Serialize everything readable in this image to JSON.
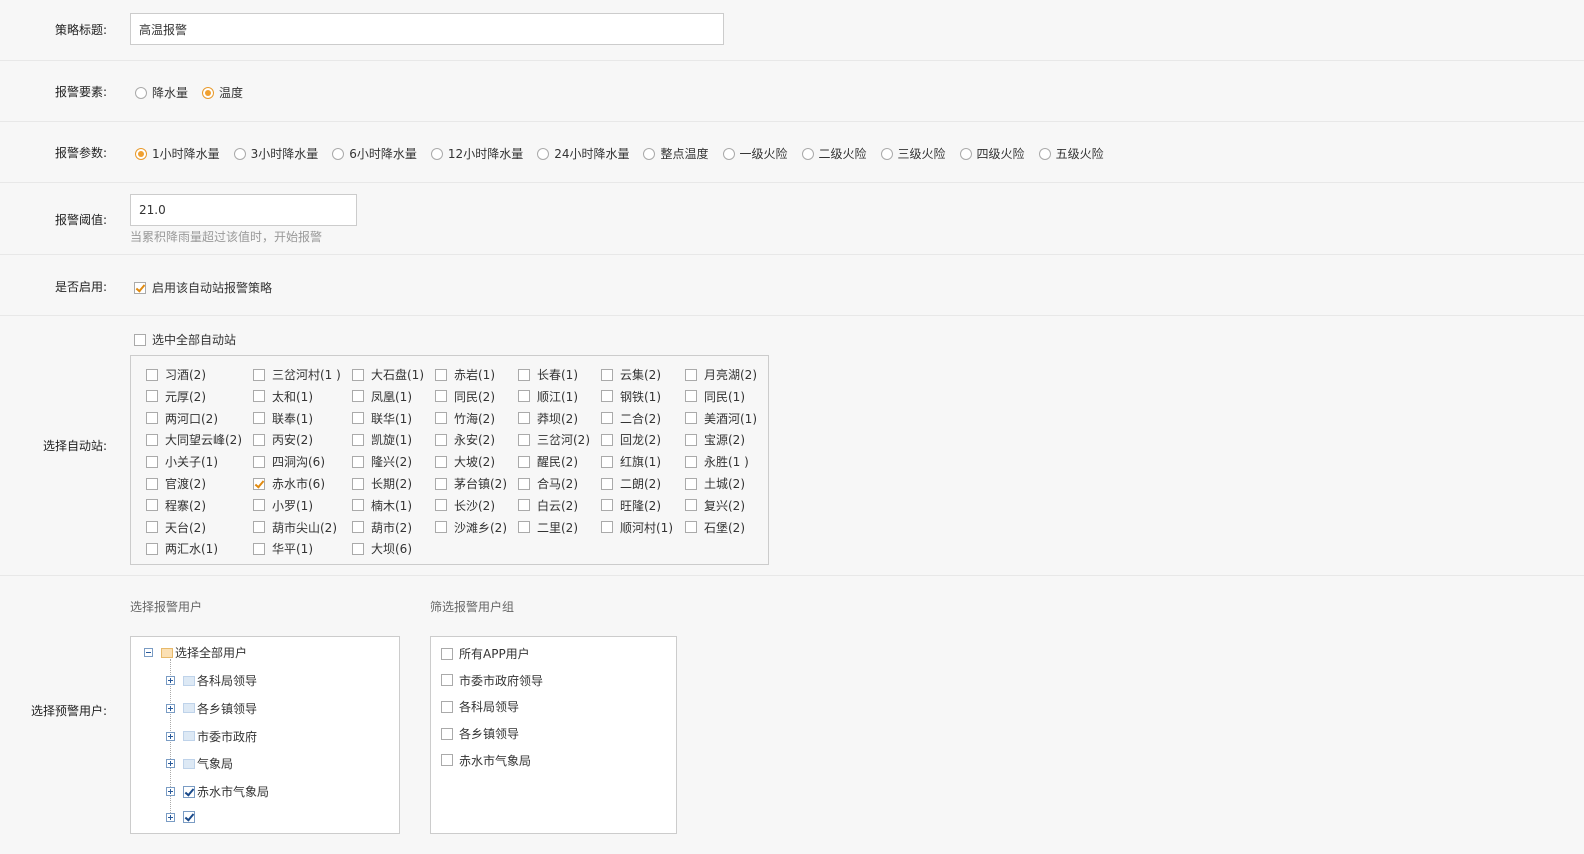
{
  "title_row": {
    "label": "策略标题:",
    "value": "高温报警"
  },
  "element_row": {
    "label": "报警要素:",
    "options": [
      {
        "label": "降水量",
        "checked": false
      },
      {
        "label": "温度",
        "checked": true
      }
    ]
  },
  "param_row": {
    "label": "报警参数:",
    "options": [
      {
        "label": "1小时降水量",
        "checked": true
      },
      {
        "label": "3小时降水量",
        "checked": false
      },
      {
        "label": "6小时降水量",
        "checked": false
      },
      {
        "label": "12小时降水量",
        "checked": false
      },
      {
        "label": "24小时降水量",
        "checked": false
      },
      {
        "label": "整点温度",
        "checked": false
      },
      {
        "label": "一级火险",
        "checked": false
      },
      {
        "label": "二级火险",
        "checked": false
      },
      {
        "label": "三级火险",
        "checked": false
      },
      {
        "label": "四级火险",
        "checked": false
      },
      {
        "label": "五级火险",
        "checked": false
      }
    ]
  },
  "threshold_row": {
    "label": "报警阈值:",
    "value": "21.0",
    "hint": "当累积降雨量超过该值时，开始报警"
  },
  "enable_row": {
    "label": "是否启用:",
    "checkbox_label": "启用该自动站报警策略",
    "checked": true
  },
  "stations_row": {
    "label": "选择自动站:",
    "select_all": "选中全部自动站",
    "columns": [
      [
        {
          "name": "习酒(2)"
        },
        {
          "name": "元厚(2)"
        },
        {
          "name": "两河口(2)"
        },
        {
          "name": "大同望云峰(2)"
        },
        {
          "name": "小关子(1)"
        },
        {
          "name": "官渡(2)"
        },
        {
          "name": "程寨(2)"
        },
        {
          "name": "天台(2)"
        },
        {
          "name": "两汇水(1)"
        }
      ],
      [
        {
          "name": "三岔河村(1 )"
        },
        {
          "name": "太和(1)"
        },
        {
          "name": "联奉(1)"
        },
        {
          "name": "丙安(2)"
        },
        {
          "name": "四洞沟(6)"
        },
        {
          "name": "赤水市(6)",
          "checked": true
        },
        {
          "name": "小罗(1)"
        },
        {
          "name": "葫市尖山(2)"
        },
        {
          "name": "华平(1)"
        }
      ],
      [
        {
          "name": "大石盘(1)"
        },
        {
          "name": "凤凰(1)"
        },
        {
          "name": "联华(1)"
        },
        {
          "name": "凯旋(1)"
        },
        {
          "name": "隆兴(2)"
        },
        {
          "name": "长期(2)"
        },
        {
          "name": "楠木(1)"
        },
        {
          "name": "葫市(2)"
        },
        {
          "name": "大坝(6)"
        }
      ],
      [
        {
          "name": "赤岩(1)"
        },
        {
          "name": "同民(2)"
        },
        {
          "name": "竹海(2)"
        },
        {
          "name": "永安(2)"
        },
        {
          "name": "大坡(2)"
        },
        {
          "name": "茅台镇(2)"
        },
        {
          "name": "长沙(2)"
        },
        {
          "name": "沙滩乡(2)"
        }
      ],
      [
        {
          "name": "长春(1)"
        },
        {
          "name": "顺江(1)"
        },
        {
          "name": "莽坝(2)"
        },
        {
          "name": "三岔河(2)"
        },
        {
          "name": "醒民(2)"
        },
        {
          "name": "合马(2)"
        },
        {
          "name": "白云(2)"
        },
        {
          "name": "二里(2)"
        }
      ],
      [
        {
          "name": "云集(2)"
        },
        {
          "name": "钢铁(1)"
        },
        {
          "name": "二合(2)"
        },
        {
          "name": "回龙(2)"
        },
        {
          "name": "红旗(1)"
        },
        {
          "name": "二朗(2)"
        },
        {
          "name": "旺隆(2)"
        },
        {
          "name": "顺河村(1)"
        }
      ],
      [
        {
          "name": "月亮湖(2)"
        },
        {
          "name": "同民(1)"
        },
        {
          "name": "美酒河(1)"
        },
        {
          "name": "宝源(2)"
        },
        {
          "name": "永胜(1 )"
        },
        {
          "name": "土城(2)"
        },
        {
          "name": "复兴(2)"
        },
        {
          "name": "石堡(2)"
        }
      ]
    ]
  },
  "users_row": {
    "label": "选择预警用户:",
    "users_title": "选择报警用户",
    "groups_title": "筛选报警用户组",
    "tree_root": "选择全部用户",
    "tree_children": [
      {
        "label": "各科局领导",
        "checked": false
      },
      {
        "label": "各乡镇领导",
        "checked": false
      },
      {
        "label": "市委市政府",
        "checked": false
      },
      {
        "label": "气象局",
        "checked": false
      },
      {
        "label": "赤水市气象局",
        "checked": true
      },
      {
        "label": "",
        "checked": true
      }
    ],
    "groups": [
      "所有APP用户",
      "市委市政府领导",
      "各科局领导",
      "各乡镇领导",
      "赤水市气象局"
    ]
  }
}
